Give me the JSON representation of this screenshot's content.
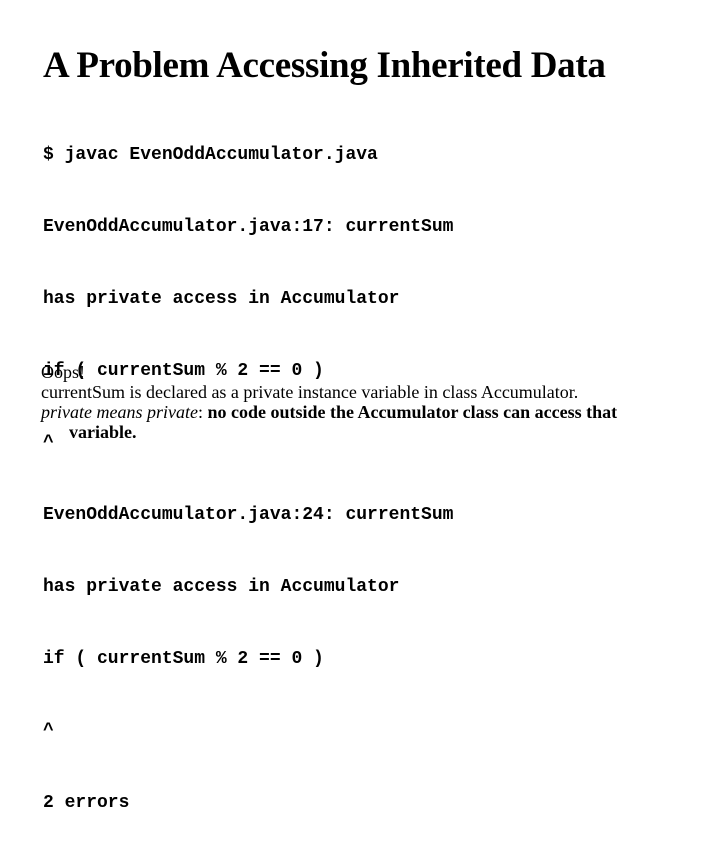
{
  "slide": {
    "title": "A Problem Accessing Inherited Data",
    "compiler_output": [
      "$ javac EvenOddAccumulator.java",
      "EvenOddAccumulator.java:17: currentSum",
      "has private access in Accumulator",
      "if ( currentSum % 2 == 0 )",
      "^",
      "EvenOddAccumulator.java:24: currentSum",
      "has private access in Accumulator",
      "if ( currentSum % 2 == 0 )",
      "^",
      "2 errors"
    ],
    "explanation": {
      "line1": "Oops!",
      "line2": "currentSum is declared as a private instance variable in class Accumulator.",
      "line3_italic": "private means private",
      "line3_sep": ": ",
      "line3_bold": "no code outside the Accumulator class can access that variable."
    }
  }
}
